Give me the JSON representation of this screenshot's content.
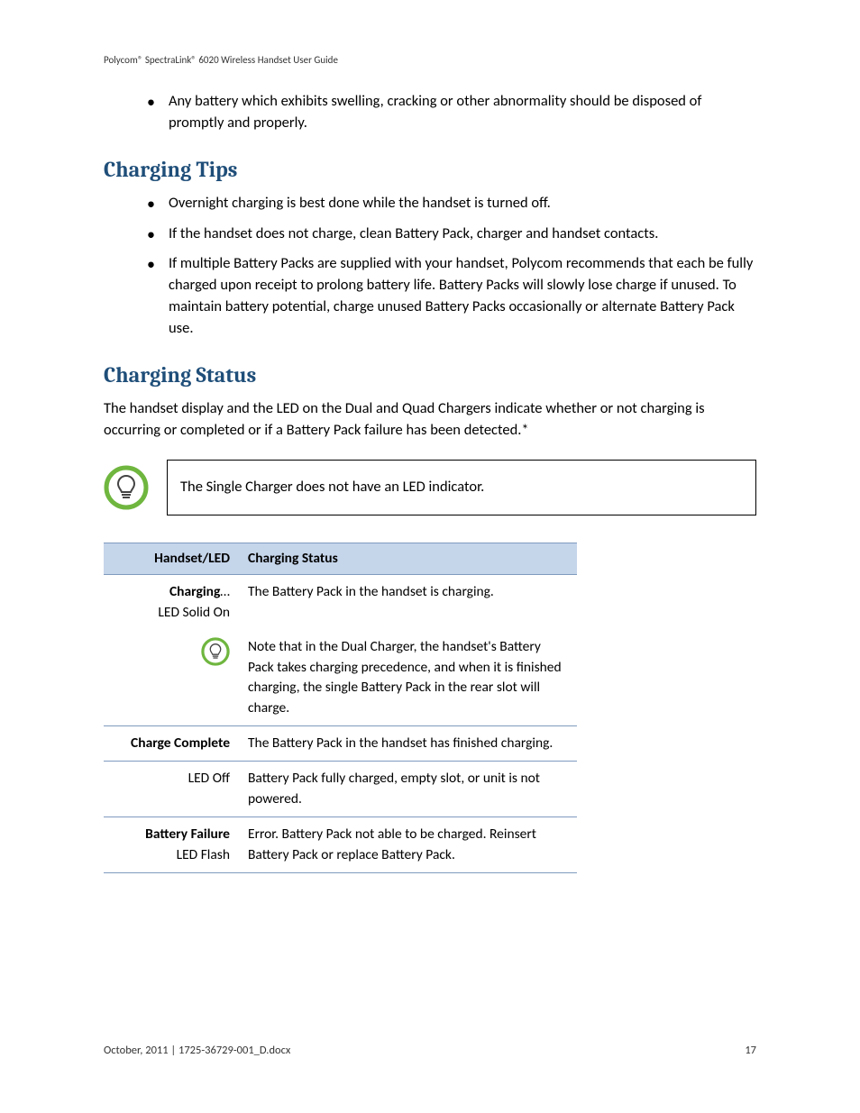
{
  "header": "Polycom® SpectraLink® 6020 Wireless Handset User Guide",
  "intro_bullet": "Any battery which exhibits swelling, cracking or other abnormality should be disposed of promptly and properly.",
  "tips": {
    "heading": "Charging Tips",
    "items": [
      "Overnight charging is best done while the handset is turned off.",
      "If the handset does not charge, clean Battery Pack, charger and handset contacts.",
      "If multiple Battery Packs are supplied with your handset, Polycom recommends that each be fully charged upon receipt to prolong battery life.  Battery Packs will slowly lose charge if unused.  To maintain battery potential, charge unused Battery Packs occasionally or alternate Battery Pack use."
    ]
  },
  "status": {
    "heading": "Charging Status",
    "intro": "The handset display and the LED on the Dual and Quad Chargers indicate whether or not charging is occurring or completed or if a Battery Pack failure has been detected.*",
    "tip_note": "The Single Charger does not have an LED indicator.",
    "table": {
      "col_left": "Handset/LED",
      "col_right": "Charging Status",
      "rows": [
        {
          "left_bold": "Charging",
          "left_suffix": "…",
          "left_line2": "LED Solid On",
          "right": "The Battery Pack in the handset is charging."
        },
        {
          "icon": true,
          "right": "Note that in the Dual Charger, the handset's Battery Pack takes charging precedence, and when it is finished charging, the single Battery Pack in the rear slot will charge."
        },
        {
          "left_bold": "Charge Complete",
          "right": "The Battery Pack in the handset has finished charging."
        },
        {
          "left_line2": "LED Off",
          "right": "Battery Pack fully charged, empty slot, or unit is not powered."
        },
        {
          "left_bold": "Battery Failure",
          "left_line2": "LED Flash",
          "right": "Error. Battery Pack not able to be charged. Reinsert Battery Pack or replace Battery Pack."
        }
      ]
    }
  },
  "footer_left": "October, 2011   |   1725-36729-001_D.docx",
  "footer_right": "17"
}
